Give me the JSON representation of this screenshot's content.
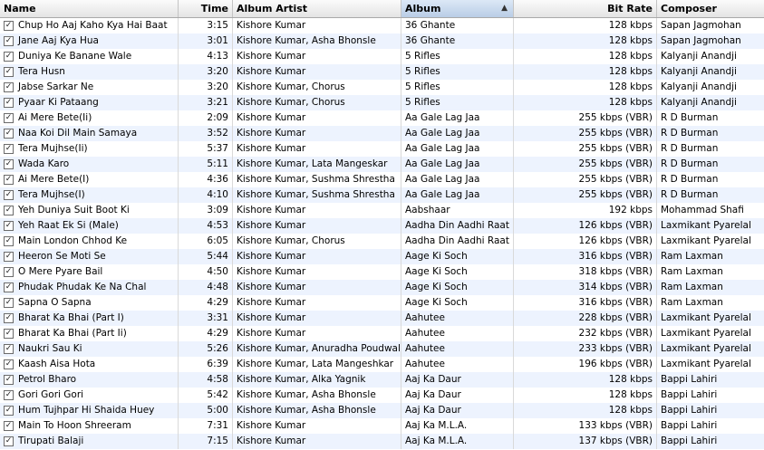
{
  "columns": {
    "name": "Name",
    "time": "Time",
    "album_artist": "Album Artist",
    "album": "Album",
    "bit_rate": "Bit Rate",
    "composer": "Composer"
  },
  "sort": {
    "column": "Album",
    "direction": "ascending",
    "icon": "sort-up-icon"
  },
  "rows": [
    {
      "name": "Chup Ho Aaj Kaho Kya Hai Baat",
      "time": "3:15",
      "album_artist": "Kishore Kumar",
      "album": "36 Ghante",
      "bit_rate": "128 kbps",
      "composer": "Sapan Jagmohan"
    },
    {
      "name": "Jane Aaj Kya Hua",
      "time": "3:01",
      "album_artist": "Kishore Kumar, Asha Bhonsle",
      "album": "36 Ghante",
      "bit_rate": "128 kbps",
      "composer": "Sapan Jagmohan"
    },
    {
      "name": "Duniya Ke Banane Wale",
      "time": "4:13",
      "album_artist": "Kishore Kumar",
      "album": "5 Rifles",
      "bit_rate": "128 kbps",
      "composer": "Kalyanji Anandji"
    },
    {
      "name": "Tera Husn",
      "time": "3:20",
      "album_artist": "Kishore Kumar",
      "album": "5 Rifles",
      "bit_rate": "128 kbps",
      "composer": "Kalyanji Anandji"
    },
    {
      "name": "Jabse Sarkar Ne",
      "time": "3:20",
      "album_artist": "Kishore Kumar, Chorus",
      "album": "5 Rifles",
      "bit_rate": "128 kbps",
      "composer": "Kalyanji Anandji"
    },
    {
      "name": "Pyaar Ki Pataang",
      "time": "3:21",
      "album_artist": "Kishore Kumar, Chorus",
      "album": "5 Rifles",
      "bit_rate": "128 kbps",
      "composer": "Kalyanji Anandji"
    },
    {
      "name": "Ai Mere Bete(Ii)",
      "time": "2:09",
      "album_artist": "Kishore Kumar",
      "album": "Aa Gale Lag Jaa",
      "bit_rate": "255 kbps (VBR)",
      "composer": "R D Burman"
    },
    {
      "name": "Naa Koi Dil Main Samaya",
      "time": "3:52",
      "album_artist": "Kishore Kumar",
      "album": "Aa Gale Lag Jaa",
      "bit_rate": "255 kbps (VBR)",
      "composer": "R D Burman"
    },
    {
      "name": "Tera Mujhse(Ii)",
      "time": "5:37",
      "album_artist": "Kishore Kumar",
      "album": "Aa Gale Lag Jaa",
      "bit_rate": "255 kbps (VBR)",
      "composer": "R D Burman"
    },
    {
      "name": "Wada Karo",
      "time": "5:11",
      "album_artist": "Kishore Kumar, Lata Mangeskar",
      "album": "Aa Gale Lag Jaa",
      "bit_rate": "255 kbps (VBR)",
      "composer": "R D Burman"
    },
    {
      "name": "Ai Mere Bete(I)",
      "time": "4:36",
      "album_artist": "Kishore Kumar, Sushma Shrestha",
      "album": "Aa Gale Lag Jaa",
      "bit_rate": "255 kbps (VBR)",
      "composer": "R D Burman"
    },
    {
      "name": "Tera Mujhse(I)",
      "time": "4:10",
      "album_artist": "Kishore Kumar, Sushma Shrestha",
      "album": "Aa Gale Lag Jaa",
      "bit_rate": "255 kbps (VBR)",
      "composer": "R D Burman"
    },
    {
      "name": "Yeh Duniya Suit Boot Ki",
      "time": "3:09",
      "album_artist": "Kishore Kumar",
      "album": "Aabshaar",
      "bit_rate": "192 kbps",
      "composer": "Mohammad Shafi"
    },
    {
      "name": "Yeh Raat Ek Si (Male)",
      "time": "4:53",
      "album_artist": "Kishore Kumar",
      "album": "Aadha Din Aadhi Raat",
      "bit_rate": "126 kbps (VBR)",
      "composer": "Laxmikant Pyarelal"
    },
    {
      "name": "Main London Chhod Ke",
      "time": "6:05",
      "album_artist": "Kishore Kumar, Chorus",
      "album": "Aadha Din Aadhi Raat",
      "bit_rate": "126 kbps (VBR)",
      "composer": "Laxmikant Pyarelal"
    },
    {
      "name": "Heeron Se Moti Se",
      "time": "5:44",
      "album_artist": "Kishore Kumar",
      "album": "Aage Ki Soch",
      "bit_rate": "316 kbps (VBR)",
      "composer": "Ram Laxman"
    },
    {
      "name": "O Mere Pyare Bail",
      "time": "4:50",
      "album_artist": "Kishore Kumar",
      "album": "Aage Ki Soch",
      "bit_rate": "318 kbps (VBR)",
      "composer": "Ram Laxman"
    },
    {
      "name": "Phudak Phudak Ke Na Chal",
      "time": "4:48",
      "album_artist": "Kishore Kumar",
      "album": "Aage Ki Soch",
      "bit_rate": "314 kbps (VBR)",
      "composer": "Ram Laxman"
    },
    {
      "name": "Sapna O Sapna",
      "time": "4:29",
      "album_artist": "Kishore Kumar",
      "album": "Aage Ki Soch",
      "bit_rate": "316 kbps (VBR)",
      "composer": "Ram Laxman"
    },
    {
      "name": "Bharat Ka Bhai (Part I)",
      "time": "3:31",
      "album_artist": "Kishore Kumar",
      "album": "Aahutee",
      "bit_rate": "228 kbps (VBR)",
      "composer": "Laxmikant Pyarelal"
    },
    {
      "name": "Bharat Ka Bhai (Part Ii)",
      "time": "4:29",
      "album_artist": "Kishore Kumar",
      "album": "Aahutee",
      "bit_rate": "232 kbps (VBR)",
      "composer": "Laxmikant Pyarelal"
    },
    {
      "name": "Naukri Sau Ki",
      "time": "5:26",
      "album_artist": "Kishore Kumar, Anuradha Poudwal",
      "album": "Aahutee",
      "bit_rate": "233 kbps (VBR)",
      "composer": "Laxmikant Pyarelal"
    },
    {
      "name": "Kaash Aisa Hota",
      "time": "6:39",
      "album_artist": "Kishore Kumar, Lata Mangeshkar",
      "album": "Aahutee",
      "bit_rate": "196 kbps (VBR)",
      "composer": "Laxmikant Pyarelal"
    },
    {
      "name": "Petrol Bharo",
      "time": "4:58",
      "album_artist": "Kishore Kumar, Alka Yagnik",
      "album": "Aaj Ka Daur",
      "bit_rate": "128 kbps",
      "composer": "Bappi Lahiri"
    },
    {
      "name": "Gori Gori Gori",
      "time": "5:42",
      "album_artist": "Kishore Kumar, Asha Bhonsle",
      "album": "Aaj Ka Daur",
      "bit_rate": "128 kbps",
      "composer": "Bappi Lahiri"
    },
    {
      "name": "Hum Tujhpar Hi Shaida Huey",
      "time": "5:00",
      "album_artist": "Kishore Kumar, Asha Bhonsle",
      "album": "Aaj Ka Daur",
      "bit_rate": "128 kbps",
      "composer": "Bappi Lahiri"
    },
    {
      "name": "Main To Hoon Shreeram",
      "time": "7:31",
      "album_artist": "Kishore Kumar",
      "album": "Aaj Ka M.L.A.",
      "bit_rate": "133 kbps (VBR)",
      "composer": "Bappi Lahiri"
    },
    {
      "name": "Tirupati Balaji",
      "time": "7:15",
      "album_artist": "Kishore Kumar",
      "album": "Aaj Ka M.L.A.",
      "bit_rate": "137 kbps (VBR)",
      "composer": "Bappi Lahiri"
    }
  ]
}
